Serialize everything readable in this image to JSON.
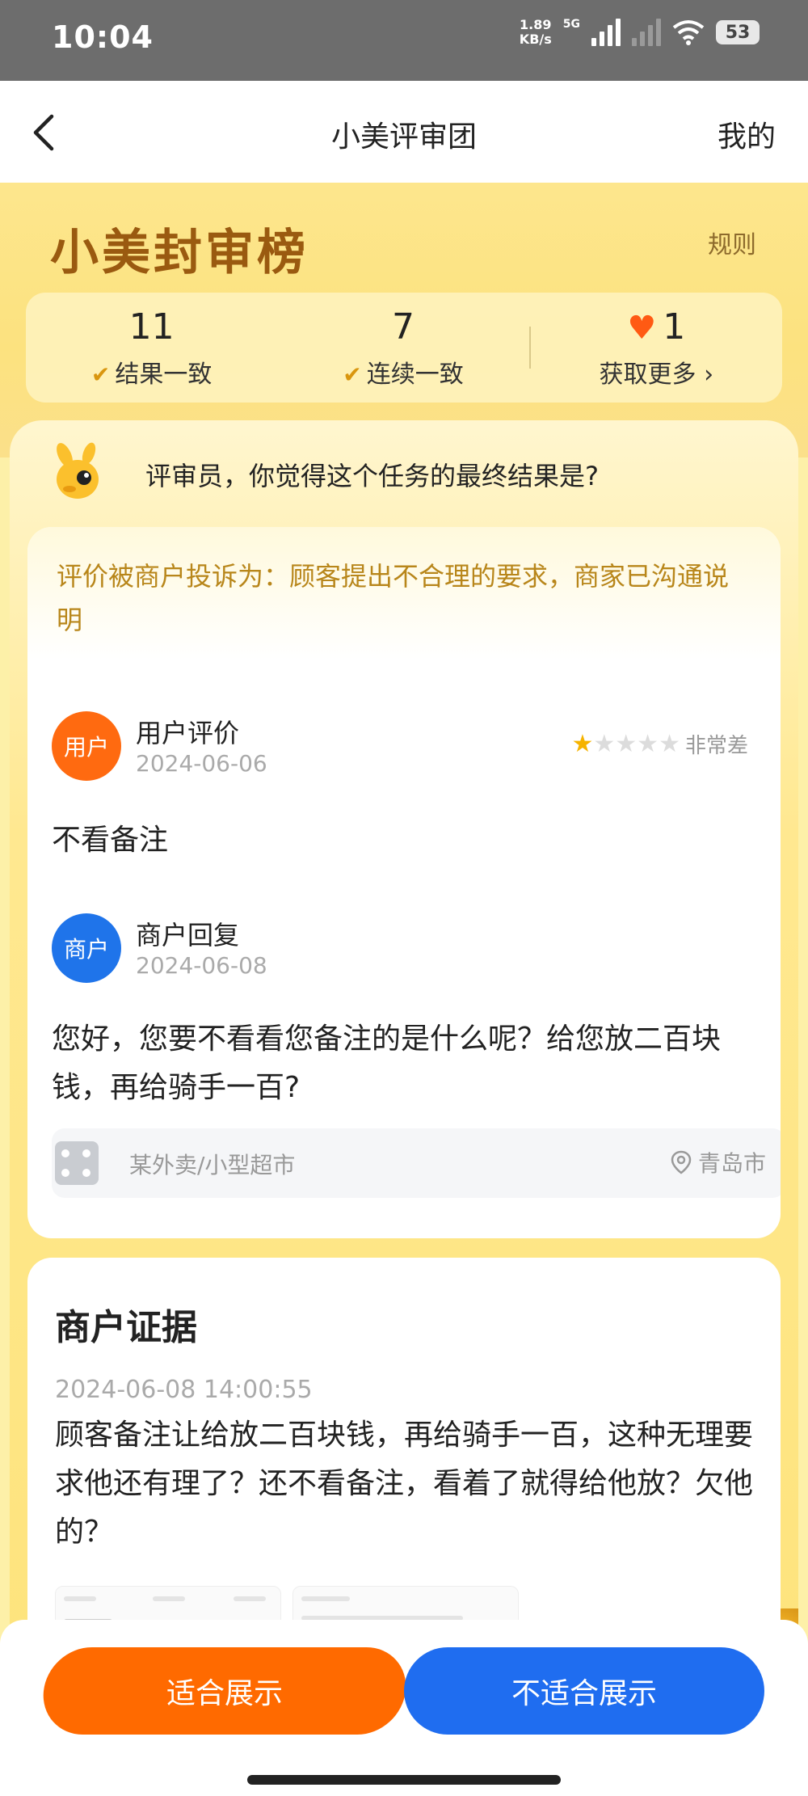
{
  "status": {
    "time": "10:04",
    "speed_value": "1.89",
    "speed_unit": "KB/s",
    "network": "5G",
    "battery": "53",
    "icons": [
      "signal-icon",
      "signal-icon",
      "wifi-icon",
      "battery-icon"
    ]
  },
  "nav": {
    "back_icon": "chevron-left-icon",
    "title": "小美评审团",
    "mine": "我的"
  },
  "banner": {
    "brand": "小美封审榜",
    "rules": "规则",
    "stats": [
      {
        "value": "11",
        "label": "结果一致",
        "icon": "check-icon"
      },
      {
        "value": "7",
        "label": "连续一致",
        "icon": "double-check-icon"
      },
      {
        "value": "1",
        "label": "获取更多 ›",
        "icon": "heart-icon"
      }
    ]
  },
  "question": {
    "text": "评审员，你觉得这个任务的最终结果是?"
  },
  "review": {
    "complaint": "评价被商户投诉为：顾客提出不合理的要求，商家已沟通说明",
    "user": {
      "avatar": "用户",
      "name": "用户评价",
      "date": "2024-06-06",
      "stars": 1,
      "stars_max": 5,
      "rating_label": "非常差",
      "body": "不看备注"
    },
    "merchant": {
      "avatar": "商户",
      "name": "商户回复",
      "date": "2024-06-08",
      "body": "您好，您要不看看您备注的是什么呢？给您放二百块钱，再给骑手一百?"
    },
    "shop": {
      "name": "某外卖/小型超市",
      "location": "青岛市"
    }
  },
  "evidence": {
    "title": "商户证据",
    "time": "2024-06-08 14:00:55",
    "body": "顾客备注让给放二百块钱，再给骑手一百，这种无理要求他还有理了？还不看备注，看着了就得给他放？欠他的？"
  },
  "actions": {
    "fit": "适合展示",
    "unfit": "不适合展示"
  },
  "colors": {
    "accent_orange": "#ff6a00",
    "accent_blue": "#1f6df0",
    "brand_brown": "#9a5a10",
    "complaint_text": "#b8861a"
  }
}
